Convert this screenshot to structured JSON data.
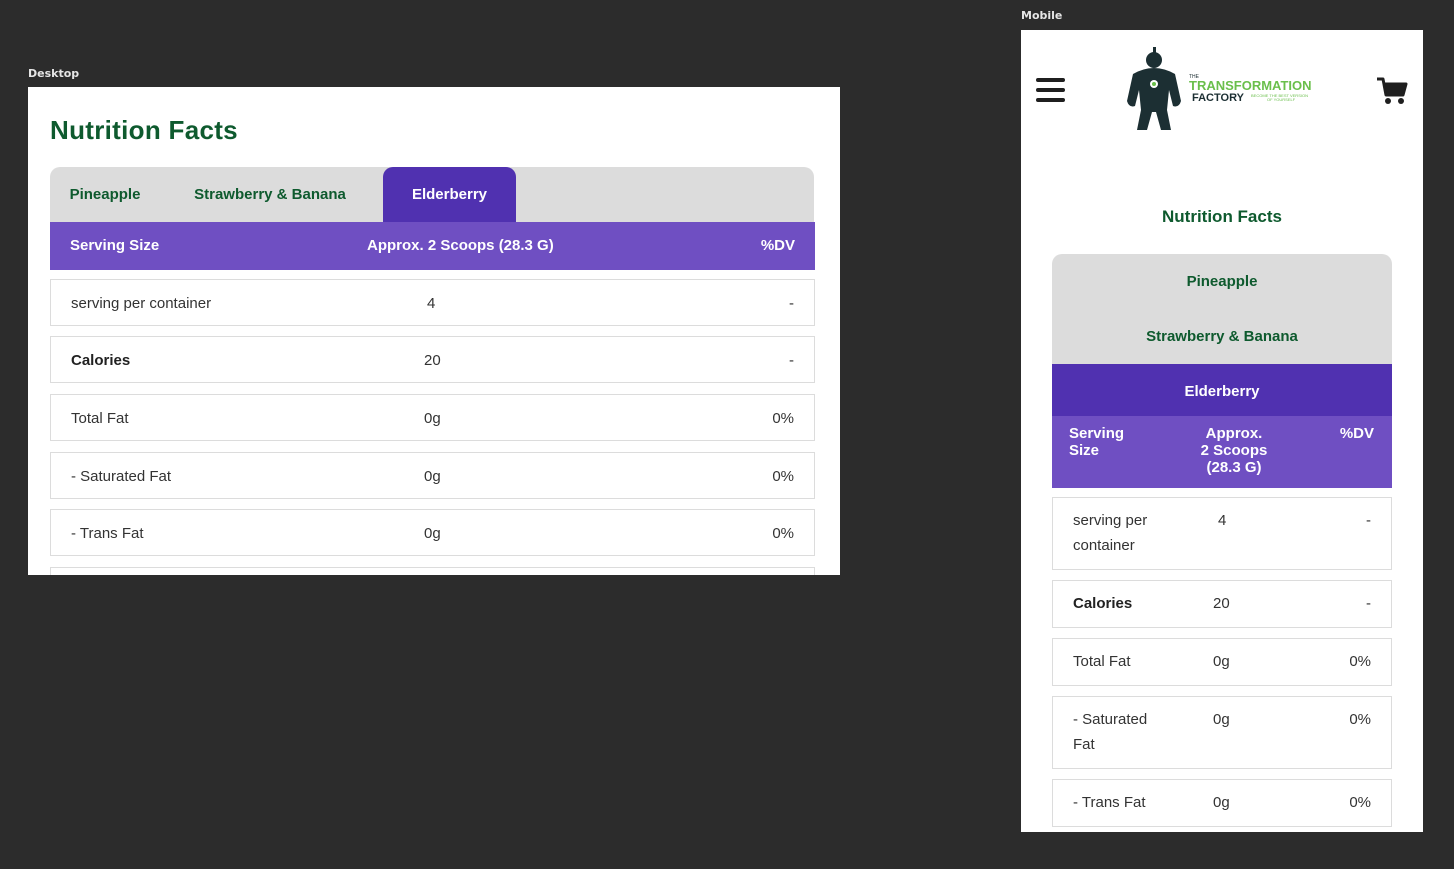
{
  "frames": {
    "desktop_label": "Desktop",
    "mobile_label": "Mobile"
  },
  "title": "Nutrition Facts",
  "tabs": [
    {
      "label": "Pineapple",
      "active": false
    },
    {
      "label": "Strawberry & Banana",
      "active": false
    },
    {
      "label": "Elderberry",
      "active": true
    }
  ],
  "header": {
    "serving_size": "Serving Size",
    "amount": "Approx. 2 Scoops (28.3 G)",
    "dv": "%DV"
  },
  "mobile_header": {
    "serving_size_line1": "Serving",
    "serving_size_line2": "Size",
    "amount_line1": "Approx.",
    "amount_line2": "2 Scoops",
    "amount_line3": "(28.3 G)",
    "dv": "%DV"
  },
  "rows": [
    {
      "name": "serving per container",
      "amount": "4",
      "dv": "-",
      "bold": false
    },
    {
      "name": "Calories",
      "amount": "20",
      "dv": "-",
      "bold": true
    },
    {
      "name": "Total Fat",
      "amount": "0g",
      "dv": "0%",
      "bold": false
    },
    {
      "name": "- Saturated Fat",
      "amount": "0g",
      "dv": "0%",
      "bold": false
    },
    {
      "name": "- Trans Fat",
      "amount": "0g",
      "dv": "0%",
      "bold": false
    }
  ],
  "mobile_rows": [
    {
      "name_line1": "serving per",
      "name_line2": "container"
    },
    {
      "name_line1": "Calories",
      "name_line2": ""
    },
    {
      "name_line1": "Total Fat",
      "name_line2": ""
    },
    {
      "name_line1": "- Saturated",
      "name_line2": "Fat"
    },
    {
      "name_line1": "- Trans Fat",
      "name_line2": ""
    }
  ],
  "logo": {
    "the": "THE",
    "brand_line1": "TRANSFORMATION",
    "brand_line2": "FACTORY",
    "tagline_line1": "BECOME THE BEST VERSION",
    "tagline_line2": "OF YOURSELF"
  },
  "icons": {
    "menu": "hamburger-menu-icon",
    "cart": "shopping-cart-icon",
    "logo": "robot-mascot-logo"
  },
  "colors": {
    "accent_purple": "#6f4fc2",
    "active_tab": "#5031b0",
    "brand_green": "#0e5a2e",
    "logo_green": "#6abf4b"
  }
}
